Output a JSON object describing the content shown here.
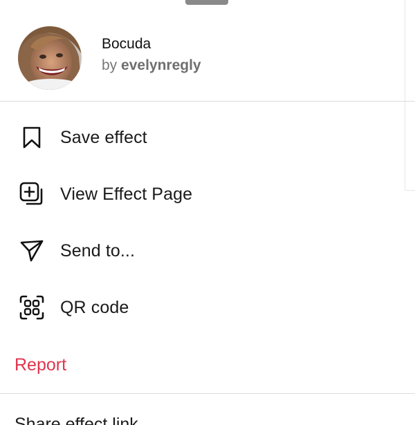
{
  "header": {
    "effect_name": "Bocuda",
    "author_prefix": "by",
    "author_handle": "evelynregly"
  },
  "menu": {
    "save": {
      "label": "Save effect",
      "icon": "bookmark-icon"
    },
    "view_page": {
      "label": "View Effect Page",
      "icon": "effect-page-icon"
    },
    "send": {
      "label": "Send to...",
      "icon": "send-icon"
    },
    "qr": {
      "label": "QR code",
      "icon": "qr-code-icon"
    }
  },
  "report": {
    "label": "Report",
    "color": "#e0344d"
  },
  "share": {
    "label": "Share effect link"
  }
}
